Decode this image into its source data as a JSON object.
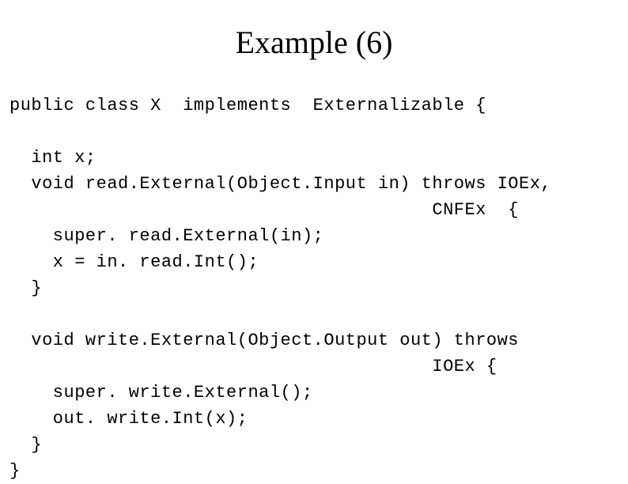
{
  "title": "Example (6)",
  "code": {
    "l1": "public class X  implements  Externalizable {",
    "l2": "",
    "l3": "  int x;",
    "l4": "  void read.External(Object.Input in) throws IOEx,",
    "l5": "                                       CNFEx  {",
    "l6": "    super. read.External(in);",
    "l7": "    x = in. read.Int();",
    "l8": "  }",
    "l9": "",
    "l10": "  void write.External(Object.Output out) throws",
    "l11": "                                       IOEx {",
    "l12": "    super. write.External();",
    "l13": "    out. write.Int(x);",
    "l14": "  }",
    "l15": "}"
  }
}
